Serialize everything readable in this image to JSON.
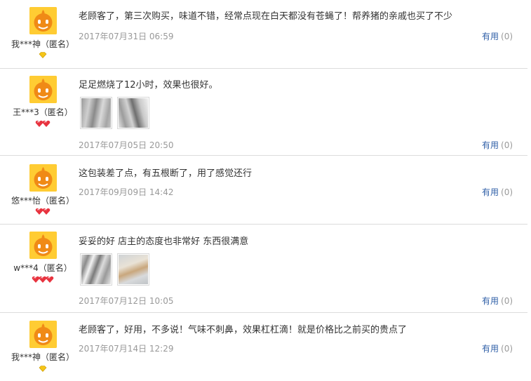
{
  "reviews": [
    {
      "user": "我***神（匿名）",
      "badge": "diamond-1",
      "content": "老顾客了，第三次购买，味道不错，经常点现在白天都没有苍蝇了！帮养猪的亲戚也买了不少",
      "date": "2017年07月31日 06:59",
      "useful_label": "有用",
      "useful_count": "(0)",
      "images": []
    },
    {
      "user": "王***3（匿名）",
      "badge": "heart-2",
      "content": "足足燃烧了12小时，效果也很好。",
      "date": "2017年07月05日 20:50",
      "useful_label": "有用",
      "useful_count": "(0)",
      "images": [
        "product-photo-1",
        "product-photo-2"
      ]
    },
    {
      "user": "悠***怡（匿名）",
      "badge": "heart-2",
      "content": "这包装差了点，有五根断了，用了感觉还行",
      "date": "2017年09月09日 14:42",
      "useful_label": "有用",
      "useful_count": "(0)",
      "images": []
    },
    {
      "user": "w***4（匿名）",
      "badge": "heart-3",
      "content": "妥妥的好 店主的态度也非常好 东西很满意",
      "date": "2017年07月12日 10:05",
      "useful_label": "有用",
      "useful_count": "(0)",
      "images": [
        "product-photo-1",
        "product-photo-2"
      ]
    },
    {
      "user": "我***神（匿名）",
      "badge": "diamond-1",
      "content": "老顾客了，好用，不多说！气味不刺鼻，效果杠杠滴！就是价格比之前买的贵点了",
      "date": "2017年07月14日 12:29",
      "useful_label": "有用",
      "useful_count": "(0)",
      "images": []
    }
  ],
  "colors": {
    "avatar_bg": "#ffcc33",
    "avatar_face": "#f08a16",
    "link": "#2f5fa7",
    "date": "#999999",
    "divider": "#dcdcdc",
    "heart": "#e8333f",
    "diamond": "#f5c518"
  }
}
